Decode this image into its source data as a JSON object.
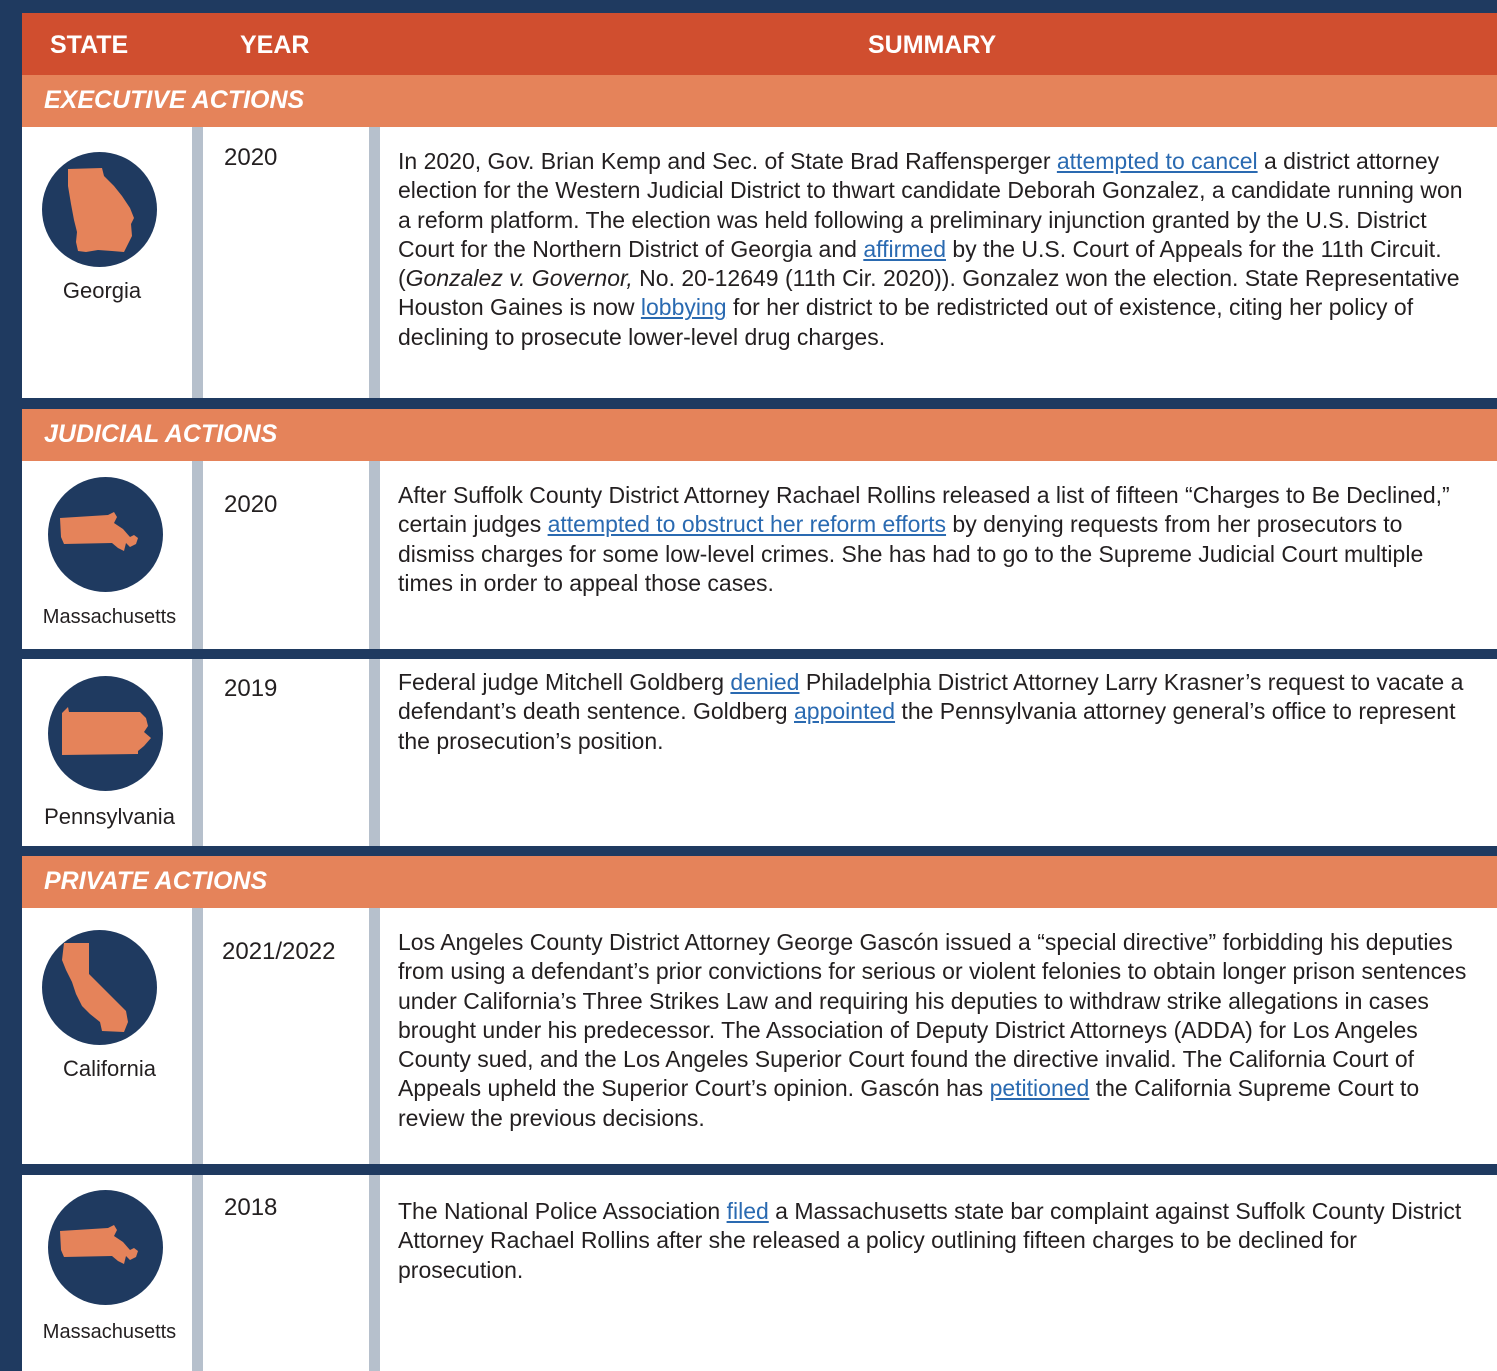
{
  "header": {
    "state": "STATE",
    "year": "YEAR",
    "summary": "SUMMARY"
  },
  "sections": [
    {
      "title": "EXECUTIVE ACTIONS"
    },
    {
      "title": "JUDICIAL ACTIONS"
    },
    {
      "title": "PRIVATE ACTIONS"
    }
  ],
  "rows": [
    {
      "state": "Georgia",
      "year": "2020",
      "icon": "georgia-map-icon",
      "segments": [
        {
          "t": " In 2020, Gov. Brian Kemp and Sec. of State Brad Raffensperger "
        },
        {
          "t": "attempted to cancel",
          "link": true
        },
        {
          "t": " a district attorney election for the Western Judicial District to thwart candidate Deborah Gonzalez, a candidate running won a reform platform. The election was held following a preliminary injunction granted by the U.S. District Court for the Northern District of Georgia and "
        },
        {
          "t": "affirmed",
          "link": true
        },
        {
          "t": " by the U.S. Court of Appeals for the 11th Circuit. ("
        },
        {
          "t": "Gonzalez v. Governor,",
          "em": true
        },
        {
          "t": " No. 20-12649 (11th Cir. 2020)). Gonzalez won the election. State Representative Houston Gaines is now "
        },
        {
          "t": "lobbying",
          "link": true
        },
        {
          "t": " for her district to be redistricted out of existence, citing her policy of declining to prosecute lower-level drug charges."
        }
      ]
    },
    {
      "state": "Massachusetts",
      "year": "2020",
      "icon": "massachusetts-map-icon",
      "segments": [
        {
          "t": "After Suffolk County District Attorney Rachael Rollins released a list of fifteen  “Charges to Be Declined,” certain judges "
        },
        {
          "t": "attempted to obstruct her reform efforts",
          "link": true
        },
        {
          "t": " by denying requests from her prosecutors to dismiss charges for some low-level crimes. She has had to go to the Supreme Judicial Court multiple times in order to appeal those cases."
        }
      ]
    },
    {
      "state": "Pennsylvania",
      "year": "2019",
      "icon": "pennsylvania-map-icon",
      "segments": [
        {
          "t": "Federal judge Mitchell Goldberg "
        },
        {
          "t": "denied",
          "link": true
        },
        {
          "t": " Philadelphia District Attorney Larry Krasner’s request to vacate a defendant’s death sentence. Goldberg "
        },
        {
          "t": "appointed",
          "link": true
        },
        {
          "t": " the Pennsylvania attorney general’s office to represent the prosecution’s position."
        }
      ]
    },
    {
      "state": "California",
      "year": "2021/2022",
      "icon": "california-map-icon",
      "segments": [
        {
          "t": "Los Angeles County District Attorney George Gascón issued a “special directive” forbidding his deputies from using a defendant’s prior convictions for serious or violent felonies to obtain longer prison sentences under California’s Three Strikes Law and requiring his deputies to withdraw strike allegations in cases brought under his predecessor. The Association of Deputy District Attorneys (ADDA) for Los Angeles County sued, and the Los Angeles Superior Court found the directive invalid. The California Court of Appeals upheld the Superior Court’s opinion. Gascón has "
        },
        {
          "t": "petitioned",
          "link": true
        },
        {
          "t": " the California Supreme Court to review the previous decisions."
        }
      ]
    },
    {
      "state": "Massachusetts",
      "year": "2018",
      "icon": "massachusetts-map-icon",
      "segments": [
        {
          "t": "The National Police Association "
        },
        {
          "t": "filed",
          "link": true
        },
        {
          "t": " a Massachusetts state bar complaint against Suffolk County District Attorney Rachael Rollins after she released a policy outlining fifteen charges to be declined for prosecution."
        }
      ]
    }
  ],
  "colors": {
    "navy": "#1f3a60",
    "header_red": "#d04e2f",
    "section_orange": "#e5835a",
    "state_orange": "#e5835a",
    "link_blue": "#2a6ab1",
    "divider_grey": "#b6c0cc"
  }
}
